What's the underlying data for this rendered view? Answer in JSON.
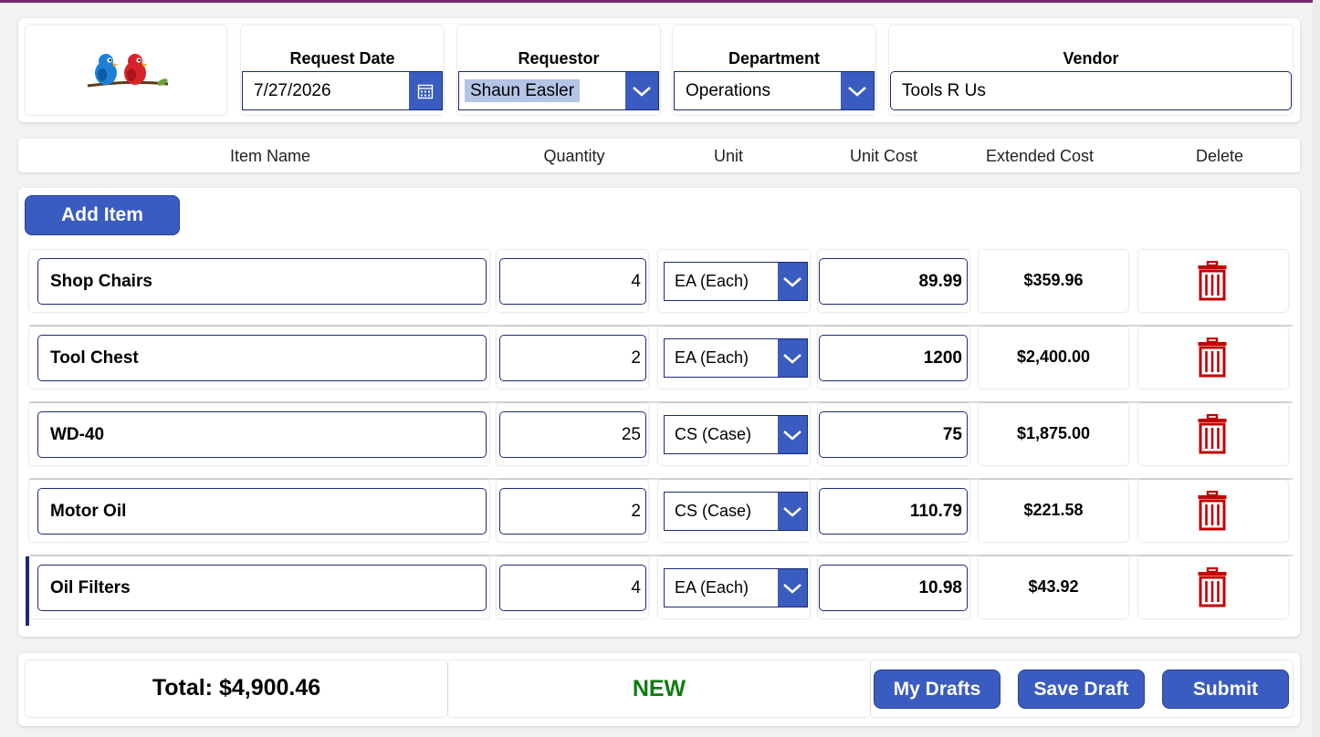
{
  "header": {
    "request_date": {
      "label": "Request Date",
      "value": "7/27/2026"
    },
    "requestor": {
      "label": "Requestor",
      "value": "Shaun Easler"
    },
    "department": {
      "label": "Department",
      "value": "Operations"
    },
    "vendor": {
      "label": "Vendor",
      "value": "Tools R Us"
    }
  },
  "columns": {
    "item_name": "Item Name",
    "quantity": "Quantity",
    "unit": "Unit",
    "unit_cost": "Unit Cost",
    "extended_cost": "Extended Cost",
    "delete": "Delete"
  },
  "add_item_label": "Add Item",
  "items": [
    {
      "name": "Shop Chairs",
      "quantity": "4",
      "unit": "EA (Each)",
      "unit_cost": "89.99",
      "extended_cost": "$359.96"
    },
    {
      "name": "Tool Chest",
      "quantity": "2",
      "unit": "EA (Each)",
      "unit_cost": "1200",
      "extended_cost": "$2,400.00"
    },
    {
      "name": "WD-40",
      "quantity": "25",
      "unit": "CS (Case)",
      "unit_cost": "75",
      "extended_cost": "$1,875.00"
    },
    {
      "name": "Motor Oil",
      "quantity": "2",
      "unit": "CS (Case)",
      "unit_cost": "110.79",
      "extended_cost": "$221.58"
    },
    {
      "name": "Oil Filters",
      "quantity": "4",
      "unit": "EA (Each)",
      "unit_cost": "10.98",
      "extended_cost": "$43.92"
    }
  ],
  "footer": {
    "total": "Total: $4,900.46",
    "status": "NEW",
    "my_drafts_label": "My Drafts",
    "save_draft_label": "Save Draft",
    "submit_label": "Submit"
  },
  "icons": {
    "logo": "birds-logo",
    "calendar": "calendar-icon",
    "dropdown": "chevron-down-icon",
    "delete": "trash-icon"
  },
  "colors": {
    "accent": "#3a5bbf",
    "border": "#1c2a78",
    "delete": "#c00000",
    "status": "#107c10",
    "top_bar": "#742774"
  }
}
